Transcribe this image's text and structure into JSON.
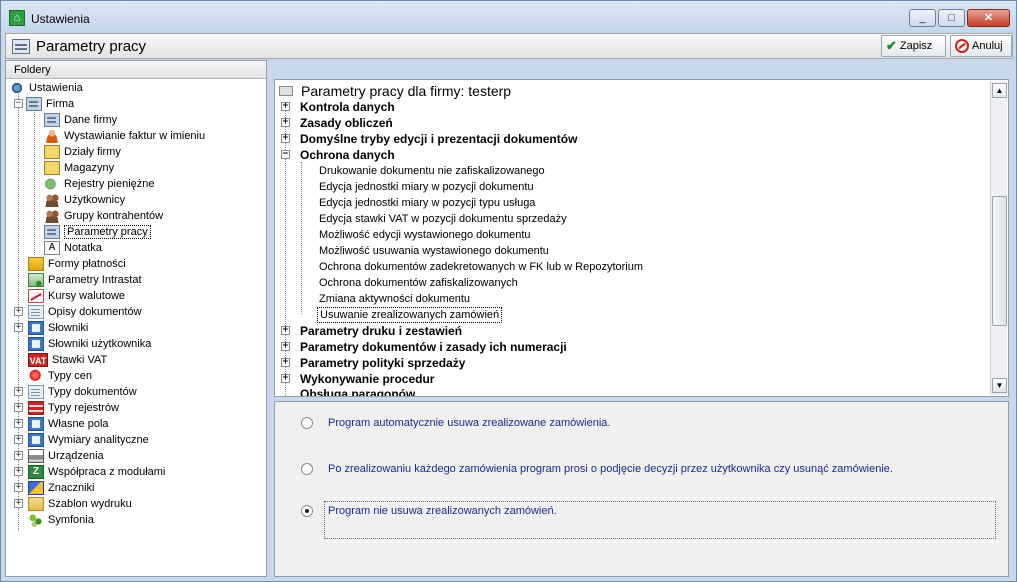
{
  "window": {
    "title": "Ustawienia",
    "min": "_",
    "max": "□",
    "close": "✕"
  },
  "header": {
    "title": "Parametry pracy",
    "save_label": "Zapisz",
    "cancel_label": "Anuluj"
  },
  "sidebar": {
    "heading": "Foldery",
    "items": [
      {
        "label": "Ustawienia"
      },
      {
        "label": "Firma"
      },
      {
        "label": "Dane firmy"
      },
      {
        "label": "Wystawianie faktur w imieniu"
      },
      {
        "label": "Działy firmy"
      },
      {
        "label": "Magazyny"
      },
      {
        "label": "Rejestry pieniężne"
      },
      {
        "label": "Użytkownicy"
      },
      {
        "label": "Grupy kontrahentów"
      },
      {
        "label": "Parametry pracy"
      },
      {
        "label": "Notatka"
      },
      {
        "label": "Formy płatności"
      },
      {
        "label": "Parametry Intrastat"
      },
      {
        "label": "Kursy walutowe"
      },
      {
        "label": "Opisy dokumentów"
      },
      {
        "label": "Słowniki"
      },
      {
        "label": "Słowniki użytkownika"
      },
      {
        "label": "Stawki VAT"
      },
      {
        "label": "Typy cen"
      },
      {
        "label": "Typy dokumentów"
      },
      {
        "label": "Typy rejestrów"
      },
      {
        "label": "Własne pola"
      },
      {
        "label": "Wymiary analityczne"
      },
      {
        "label": "Urządzenia"
      },
      {
        "label": "Współpraca z modułami"
      },
      {
        "label": "Znaczniki"
      },
      {
        "label": "Szablon wydruku"
      },
      {
        "label": "Symfonia"
      }
    ],
    "vat_icon_text": "VAT",
    "notatka_icon_text": "A",
    "coop_icon_text": "Z"
  },
  "params": {
    "heading": "Parametry pracy dla firmy: testerp",
    "groups_top": [
      "Kontrola danych",
      "Zasady obliczeń",
      "Domyślne tryby edycji i prezentacji dokumentów",
      "Ochrona danych"
    ],
    "leaves": [
      "Drukowanie dokumentu nie zafiskalizowanego",
      "Edycja jednostki miary w pozycji dokumentu",
      "Edycja jednostki miary w pozycji typu usługa",
      "Edycja stawki VAT w pozycji dokumentu sprzedaży",
      "Możliwość edycji wystawionego dokumentu",
      "Możliwość usuwania wystawionego dokumentu",
      "Ochrona dokumentów zadekretowanych w FK lub w Repozytorium",
      "Ochrona dokumentów zafiskalizowanych",
      "Zmiana aktywności dokumentu",
      "Usuwanie zrealizowanych zamówień"
    ],
    "groups_bottom": [
      "Parametry druku i zestawień",
      "Parametry dokumentów i zasady ich numeracji",
      "Parametry polityki sprzedaży",
      "Wykonywanie procedur",
      "Obsługa paragonów"
    ],
    "expand_plus": "+",
    "expand_minus": "−"
  },
  "options": [
    {
      "label": "Program automatycznie usuwa zrealizowane zamówienia.",
      "selected": false
    },
    {
      "label": "Po zrealizowaniu każdego zamówienia program prosi o podjęcie decyzji przez użytkownika czy usunąć zamówienie.",
      "selected": false
    },
    {
      "label": "Program nie usuwa zrealizowanych zamówień.",
      "selected": true
    }
  ],
  "scroll": {
    "up": "▲",
    "down": "▼"
  }
}
